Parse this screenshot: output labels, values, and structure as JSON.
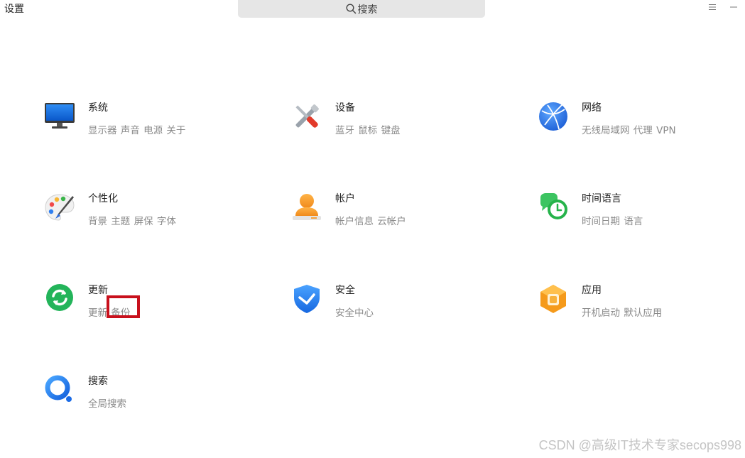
{
  "app": {
    "title": "设置"
  },
  "search": {
    "placeholder": "搜索",
    "icon": "search-icon"
  },
  "window_controls": {
    "menu_icon": "menu-icon",
    "minimize_icon": "minimize-icon"
  },
  "items": [
    {
      "id": "system",
      "title": "系统",
      "desc": "显示器 声音 电源 关于",
      "icon": "monitor-icon"
    },
    {
      "id": "devices",
      "title": "设备",
      "desc": "蓝牙 鼠标 键盘",
      "icon": "tools-icon"
    },
    {
      "id": "network",
      "title": "网络",
      "desc": "无线局域网 代理 VPN",
      "icon": "globe-icon"
    },
    {
      "id": "personalize",
      "title": "个性化",
      "desc": "背景 主题 屏保 字体",
      "icon": "palette-icon"
    },
    {
      "id": "account",
      "title": "帐户",
      "desc": "帐户信息 云帐户",
      "icon": "user-icon"
    },
    {
      "id": "time-language",
      "title": "时间语言",
      "desc": "时间日期 语言",
      "icon": "chat-clock-icon"
    },
    {
      "id": "update",
      "title": "更新",
      "desc": "更新 备份",
      "icon": "refresh-icon"
    },
    {
      "id": "security",
      "title": "安全",
      "desc": "安全中心",
      "icon": "shield-icon"
    },
    {
      "id": "apps",
      "title": "应用",
      "desc": "开机启动 默认应用",
      "icon": "cube-icon"
    },
    {
      "id": "search",
      "title": "搜索",
      "desc": "全局搜索",
      "icon": "magnifier-icon"
    }
  ],
  "colors": {
    "highlight_border": "#c8101c",
    "desc_text": "#8a8a8a"
  },
  "watermark": "CSDN @高级IT技术专家secops998"
}
